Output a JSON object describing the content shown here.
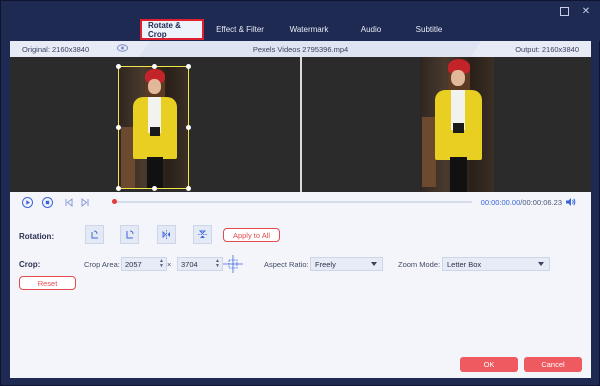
{
  "tabs": [
    {
      "label": "Rotate & Crop",
      "active": true
    },
    {
      "label": "Effect & Filter",
      "active": false
    },
    {
      "label": "Watermark",
      "active": false
    },
    {
      "label": "Audio",
      "active": false
    },
    {
      "label": "Subtitle",
      "active": false
    }
  ],
  "info": {
    "original": "Original: 2160x3840",
    "filename": "Pexels Videos 2795396.mp4",
    "output": "Output: 2160x3840"
  },
  "player": {
    "current_time": "00:00:00.00",
    "total_time": "/00:00:06.23",
    "progress": 0.0
  },
  "rotation": {
    "label": "Rotation:",
    "apply_all": "Apply to All"
  },
  "crop": {
    "label": "Crop:",
    "area_label": "Crop Area:",
    "width": "2057",
    "times": "×",
    "height": "3704",
    "aspect_label": "Aspect Ratio:",
    "aspect_value": "Freely",
    "zoom_label": "Zoom Mode:",
    "zoom_value": "Letter Box",
    "reset": "Reset"
  },
  "footer": {
    "ok": "OK",
    "cancel": "Cancel"
  },
  "colors": {
    "accent": "#ee5a60",
    "frame": "#1f2a52",
    "highlight_border": "#e02030"
  }
}
